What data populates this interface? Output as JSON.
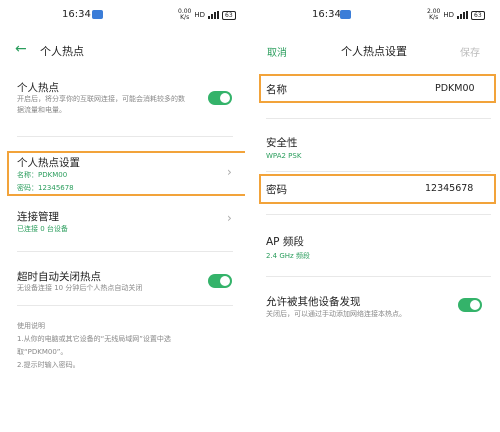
{
  "left": {
    "status": {
      "time": "16:34",
      "speed_top": "0.00",
      "speed_bottom": "K/s",
      "hd": "HD",
      "net": "4G",
      "battery": "63"
    },
    "header": {
      "title": "个人热点"
    },
    "hotspot": {
      "title": "个人热点",
      "desc": "开启后，将分享你的互联网连接，可能会消耗较多的数据流量和电量。"
    },
    "settings": {
      "title": "个人热点设置",
      "name": "名称：PDKM00",
      "password": "密码：12345678"
    },
    "connection": {
      "title": "连接管理",
      "status": "已连接 0 台设备"
    },
    "timeout": {
      "title": "超时自动关闭热点",
      "desc": "无设备连接 10 分钟后个人热点自动关闭"
    },
    "help": {
      "title": "使用说明",
      "line1": "1.从你的电脑或其它设备的“无线局域网”设置中选",
      "line2": "取“PDKM00”。",
      "line3": "2.提示时输入密码。"
    }
  },
  "right": {
    "status": {
      "time": "16:34",
      "speed_top": "2.00",
      "speed_bottom": "K/s",
      "hd": "HD",
      "net": "4G",
      "battery": "63"
    },
    "header": {
      "cancel": "取消",
      "title": "个人热点设置",
      "save": "保存"
    },
    "name": {
      "label": "名称",
      "value": "PDKM00"
    },
    "security": {
      "label": "安全性",
      "value": "WPA2 PSK"
    },
    "password": {
      "label": "密码",
      "value": "12345678"
    },
    "band": {
      "label": "AP 频段",
      "value": "2.4 GHz 频段"
    },
    "discover": {
      "title": "允许被其他设备发现",
      "desc": "关闭后，可以通过手动添加网络连接本热点。"
    }
  },
  "colors": {
    "accent_green": "#34b36a",
    "highlight_orange": "#f2a33a"
  },
  "icons": {
    "back": "arrow-left",
    "chevron": "chevron-right"
  }
}
